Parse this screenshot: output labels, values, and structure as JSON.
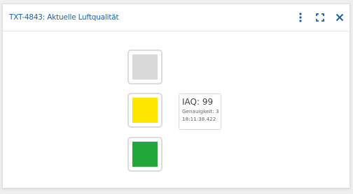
{
  "widget": {
    "title": "TXT-4843: Aktuelle Luftqualität",
    "title_color": "#1f5fa8",
    "icon_color": "#1f5fa8",
    "icons": [
      "more-vertical-icon",
      "fullscreen-icon",
      "close-icon"
    ]
  },
  "traffic_light": {
    "top_color": "#d9d9d9",
    "middle_color": "#ffe600",
    "bottom_color": "#22a83a",
    "active": "middle"
  },
  "reading": {
    "iaq_label": "IAQ:",
    "iaq_value": "99",
    "accuracy_label": "Genauigkeit:",
    "accuracy_value": "3",
    "timestamp": "18:11:38.422"
  }
}
